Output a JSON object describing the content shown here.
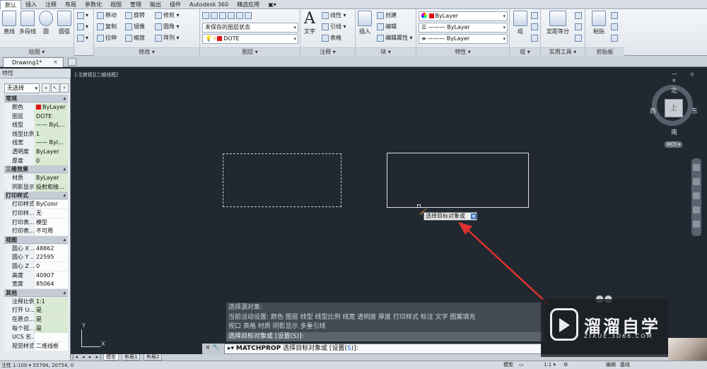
{
  "ribbon": {
    "tabs": [
      "默认",
      "插入",
      "注释",
      "布局",
      "参数化",
      "视图",
      "管理",
      "输出",
      "插件",
      "Autodesk 360",
      "精选应用",
      "▣▾"
    ],
    "active_tab": "默认",
    "panels": {
      "draw": {
        "title": "绘图 ▾",
        "buttons": [
          "直线",
          "多段线",
          "圆",
          "圆弧"
        ]
      },
      "modify": {
        "title": "修改 ▾",
        "rows": [
          "移动",
          "旋转",
          "修剪 ▾",
          "复制",
          "镜像",
          "圆角 ▾",
          "拉伸",
          "缩放",
          "阵列 ▾"
        ]
      },
      "layers": {
        "title": "图层 ▾",
        "state": "未保存的图层状态",
        "current_layer": "DOTE"
      },
      "annotation": {
        "title": "注释 ▾",
        "text_button": "文字",
        "rows": [
          "线性 ▾",
          "引线 ▾",
          "表格"
        ]
      },
      "block": {
        "title": "块 ▾",
        "insert": "插入",
        "rows": [
          "创建",
          "编辑",
          "编辑属性 ▾"
        ]
      },
      "properties": {
        "title": "特性 ▾",
        "color": "ByLayer",
        "linetype": "ByLayer",
        "lineweight": "ByLayer"
      },
      "groups": {
        "title": "组 ▾",
        "button": "组"
      },
      "utilities": {
        "title": "实用工具 ▾",
        "button": "定距等分"
      },
      "clipboard": {
        "title": "剪贴板",
        "button": "粘贴"
      }
    }
  },
  "document": {
    "tab": "Drawing1*",
    "close": "×"
  },
  "palette": {
    "title": "特性",
    "selection": "无选择",
    "sections": [
      {
        "name": "常规",
        "rows": [
          [
            "颜色",
            "ByLayer"
          ],
          [
            "图层",
            "DOTE"
          ],
          [
            "线型",
            "—— ByL..."
          ],
          [
            "线型比例",
            "1"
          ],
          [
            "线宽",
            "—— Byl..."
          ],
          [
            "透明度",
            "ByLayer"
          ],
          [
            "厚度",
            "0"
          ]
        ]
      },
      {
        "name": "三维效果",
        "rows": [
          [
            "材质",
            "ByLayer"
          ],
          [
            "阴影显示",
            "投射和接..."
          ]
        ]
      },
      {
        "name": "打印样式",
        "rows": [
          [
            "打印样式",
            "ByColor"
          ],
          [
            "打印样...",
            "无"
          ],
          [
            "打印表...",
            "模型"
          ],
          [
            "打印表...",
            "不可用"
          ]
        ]
      },
      {
        "name": "视图",
        "rows": [
          [
            "圆心 X ...",
            "48862"
          ],
          [
            "圆心 Y ...",
            "22595"
          ],
          [
            "圆心 Z ...",
            "0"
          ],
          [
            "高度",
            "40907"
          ],
          [
            "宽度",
            "85064"
          ]
        ]
      },
      {
        "name": "其他",
        "rows": [
          [
            "注释比例",
            "1:1"
          ],
          [
            "打开 U...",
            "是"
          ],
          [
            "在原点...",
            "是"
          ],
          [
            "每个视...",
            "是"
          ],
          [
            "UCS 名...",
            ""
          ],
          [
            "视觉样式",
            "二维线框"
          ]
        ]
      }
    ]
  },
  "viewport": {
    "label": "[-][俯视][二维线框]",
    "controls": "— ▫ ×",
    "viewcube": {
      "top": "上",
      "north": "北",
      "south": "南",
      "east": "东",
      "west": "西",
      "wcs": "WCS ▾"
    },
    "tooltip": "选择目标对象或",
    "ucs": {
      "x": "X",
      "y": "Y"
    }
  },
  "command": {
    "history": [
      "选择源对象:",
      "当前活动设置:  颜色 图层 线型 线型比例 线宽 透明度 厚度 打印样式 标注 文字 图案填充",
      "视口 表格 材质 阴影显示 多重引线",
      "选择目标对象或 [设置(S)]:"
    ],
    "tools": "× 🔧",
    "prompt_cmd": "MATCHPROP",
    "prompt_text": "选择目标对象或 [设置(",
    "prompt_opt": "S",
    "prompt_end": ")]:"
  },
  "layout_tabs": [
    "模型",
    "布局1",
    "布局2"
  ],
  "status": {
    "coords": "注性 1:100 ▾  55794, 20754, 0",
    "right": [
      "模型",
      "▭",
      "1:1 ▾",
      "⚙",
      "编辑",
      "基线"
    ]
  },
  "watermark": {
    "title": "溜溜自学",
    "url": "ZIXUE.3D66.COM"
  }
}
